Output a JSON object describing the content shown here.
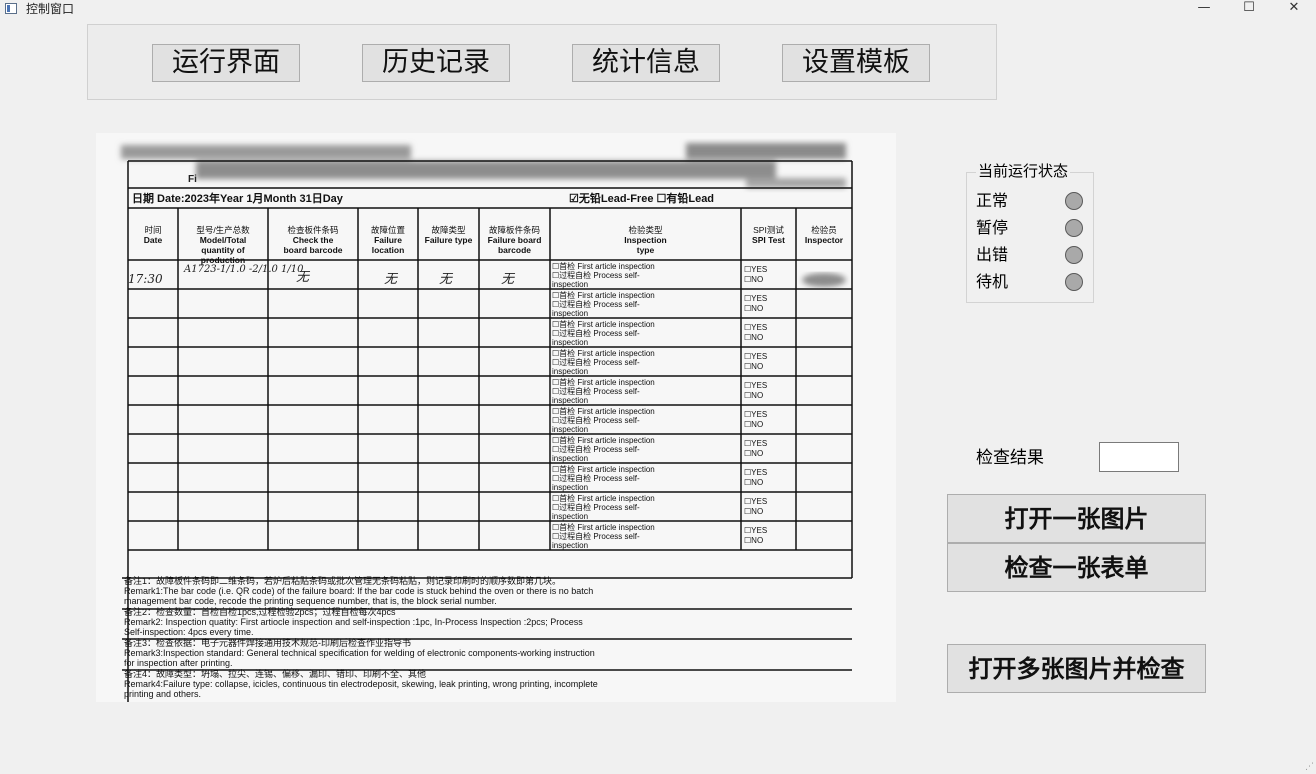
{
  "window": {
    "title": "控制窗口",
    "minimize": "—",
    "maximize": "☐",
    "close": "✕"
  },
  "nav": {
    "run": "运行界面",
    "history": "历史记录",
    "stats": "统计信息",
    "template": "设置模板"
  },
  "form": {
    "date_row": "日期 Date:2023年Year 1月Month 31日Day",
    "leadfree": "☑无铅Lead-Free  ☐有铅Lead",
    "headers": [
      {
        "cn": "时间",
        "en": "Date"
      },
      {
        "cn": "型号/生产总数",
        "en": "Model/Total quantity of production"
      },
      {
        "cn": "检查板件条码",
        "en": "Check the board barcode"
      },
      {
        "cn": "故障位置",
        "en": "Failure location"
      },
      {
        "cn": "故障类型",
        "en": "Failure type"
      },
      {
        "cn": "故障板件条码",
        "en": "Failure board barcode"
      },
      {
        "cn": "检验类型",
        "en": "Inspection type"
      },
      {
        "cn": "SPI测试",
        "en": "SPI Test"
      },
      {
        "cn": "检验员",
        "en": "Inspector"
      }
    ],
    "first_row": {
      "time": "17:30",
      "model": "A1723-1/1.0 -2/1.0  1/10",
      "barcode": "无",
      "location": "无",
      "type": "无",
      "failure_barcode": "无"
    },
    "insp_line1": "☐首检 First article inspection",
    "insp_line2": "☐过程自检 Process self-",
    "insp_line3": "inspection",
    "spi_yes": "☐YES",
    "spi_no": "☐NO",
    "remarks": [
      "备注1：故障板件条码即二维条码，若炉后粘贴条码或批次管理无条码粘贴，则记录印刷时的顺序数即第几块。",
      "Remark1:The bar code (i.e. QR code) of the failure board: If the bar code is stuck behind the oven or there is no batch",
      "management bar code, recode the printing sequence number, that is, the block serial number.",
      "备注2：检查数量：首检自检1pcs,过程检验2pcs；过程自检每次4pcs",
      "Remark2: Inspection quatity: First artiocle inspection and self-inspection :1pc, In-Process Inspection :2pcs; Process",
      "Self-inspection: 4pcs every time.",
      "备注3：检查依据：电子元器件焊接通用技术规范-印刷后检查作业指导书",
      "Remark3:Inspection standard: General technical specification for welding of electronic components-working instruction",
      "for inspection after printing.",
      "备注4：故障类型：坍塌、拉尖、连锡、偏移、漏印、错印、印刷不全、其他",
      "Remark4:Failure type: collapse, icicles, continuous tin electrodeposit, skewing, leak printing, wrong printing, incomplete",
      "printing and others."
    ]
  },
  "status": {
    "title": "当前运行状态",
    "items": [
      "正常",
      "暂停",
      "出错",
      "待机"
    ]
  },
  "result": {
    "label": "检查结果",
    "value": ""
  },
  "actions": {
    "open_one": "打开一张图片",
    "check_one": "检查一张表单",
    "open_many": "打开多张图片并检查"
  },
  "colors": {
    "led_off": "#a9a9a9",
    "button_bg": "#e1e1e1",
    "window_bg": "#f0f0f0"
  }
}
